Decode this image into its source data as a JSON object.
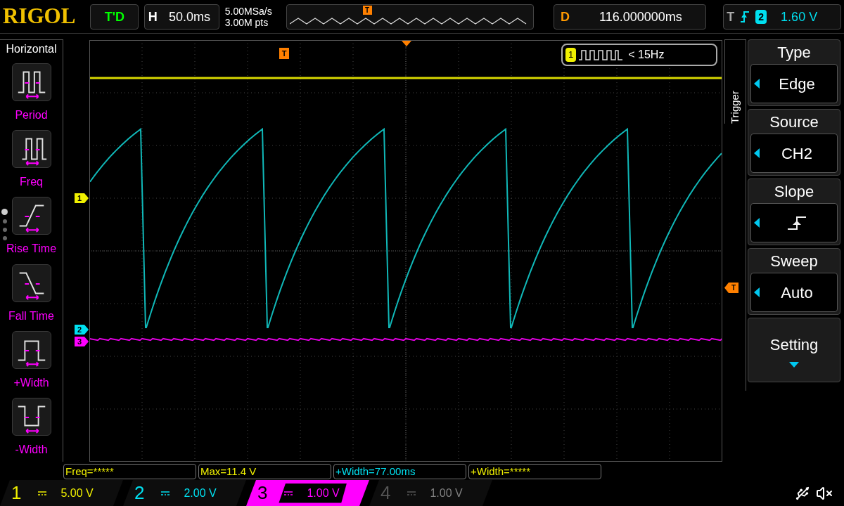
{
  "header": {
    "logo": "RIGOL",
    "run_status": "T'D",
    "horizontal": {
      "label": "H",
      "value": "50.0ms"
    },
    "sample_rate": "5.00MSa/s",
    "memory_depth": "3.00M pts",
    "memory_marker": "T",
    "delay": {
      "label": "D",
      "value": "116.000000ms"
    },
    "trigger": {
      "label": "T",
      "source": "2",
      "level": "1.60 V"
    }
  },
  "measure_menu": {
    "title": "Horizontal",
    "items": [
      {
        "label": "Period",
        "kind": "period"
      },
      {
        "label": "Freq",
        "kind": "freq"
      },
      {
        "label": "Rise Time",
        "kind": "rise"
      },
      {
        "label": "Fall Time",
        "kind": "fall"
      },
      {
        "label": "+Width",
        "kind": "pwidth"
      },
      {
        "label": "-Width",
        "kind": "nwidth"
      }
    ],
    "pages": [
      {
        "selected": true
      },
      {
        "selected": false
      },
      {
        "selected": false
      },
      {
        "selected": false
      }
    ]
  },
  "plot": {
    "trigger_position_marker": "T",
    "trigger_level_marker": "T",
    "channel_markers": [
      {
        "label": "1",
        "color": "#f0f000",
        "kind": "ch1"
      },
      {
        "label": "2",
        "color": "#00e0f0",
        "kind": "ch2"
      },
      {
        "label": "3",
        "color": "#ff00ff",
        "kind": "ch3"
      }
    ],
    "frequency_counter": {
      "channel": "1",
      "value": "< 15Hz"
    }
  },
  "trigger_menu": {
    "title": "Trigger",
    "items": [
      {
        "label": "Type",
        "value": "Edge",
        "kind": "select"
      },
      {
        "label": "Source",
        "value": "CH2",
        "kind": "select"
      },
      {
        "label": "Slope",
        "kind": "slope"
      },
      {
        "label": "Sweep",
        "value": "Auto",
        "kind": "select"
      },
      {
        "label": "Setting",
        "kind": "submenu"
      }
    ]
  },
  "measurements": [
    {
      "text": "Freq=*****",
      "color": "#f0f000"
    },
    {
      "text": "Max=11.4 V",
      "color": "#f0f000"
    },
    {
      "text": "+Width=77.00ms",
      "color": "#00e0f0"
    },
    {
      "text": "+Width=*****",
      "color": "#f0f000"
    }
  ],
  "channels": [
    {
      "number": "1",
      "scale": "5.00 V",
      "color": "#f0f000",
      "enabled": true,
      "selected": false
    },
    {
      "number": "2",
      "scale": "2.00 V",
      "color": "#00e0f0",
      "enabled": true,
      "selected": false
    },
    {
      "number": "3",
      "scale": "1.00 V",
      "color": "#ff00ff",
      "enabled": true,
      "selected": true
    },
    {
      "number": "4",
      "scale": "1.00 V",
      "color": "#808080",
      "enabled": false,
      "selected": false
    }
  ]
}
